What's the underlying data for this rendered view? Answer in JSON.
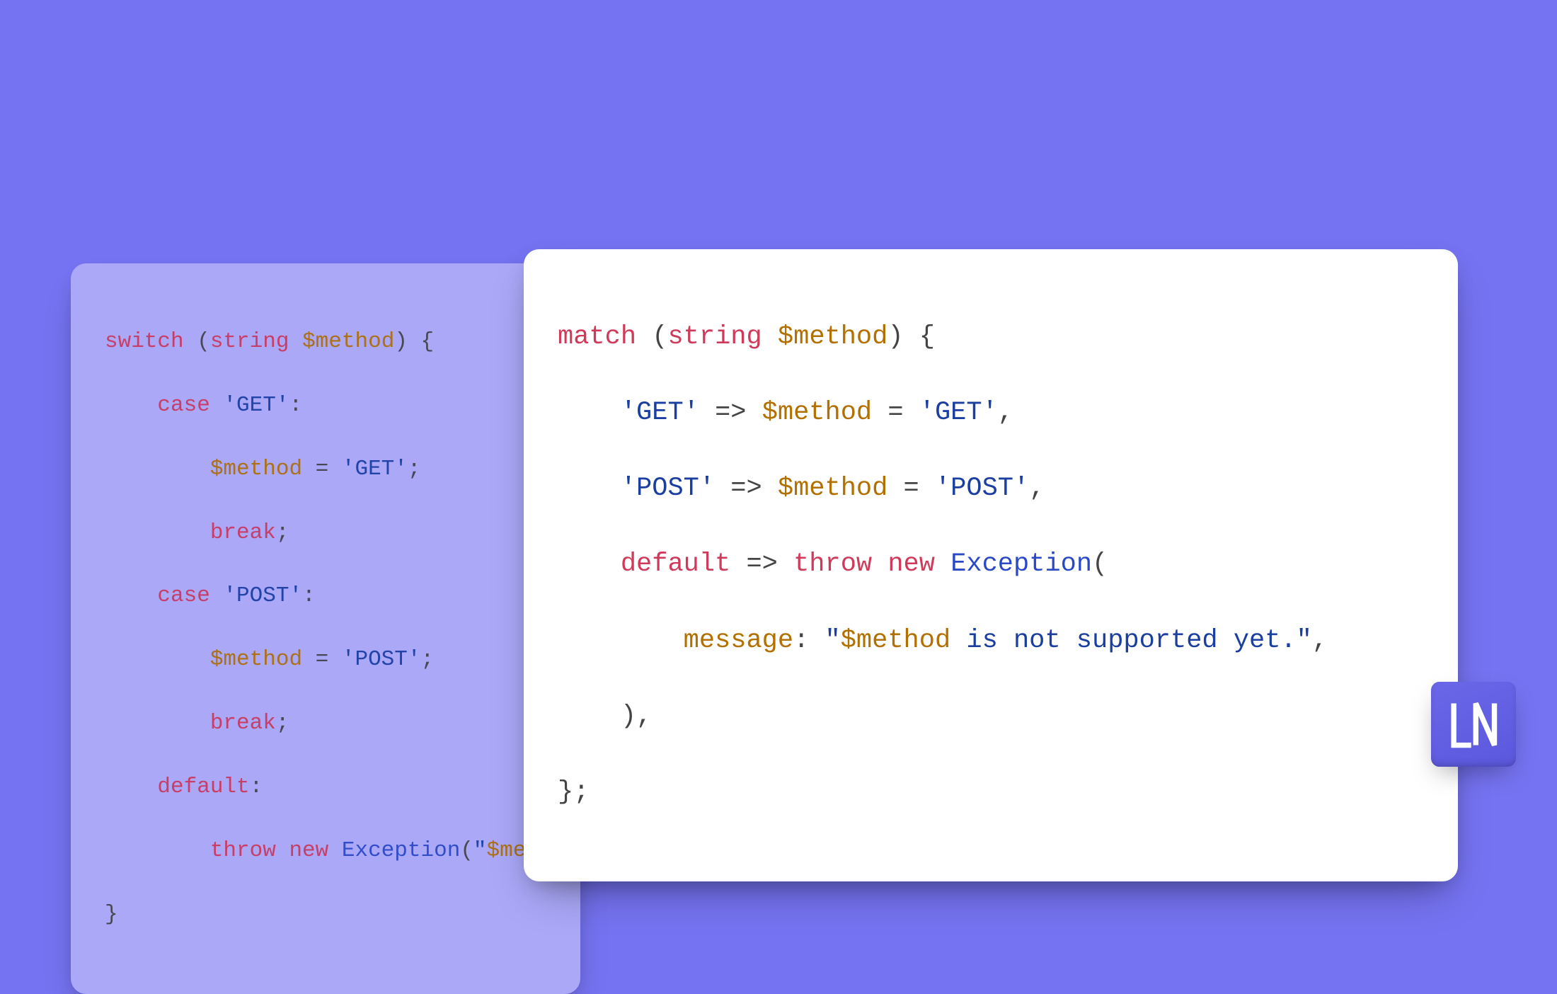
{
  "colors": {
    "background": "#7673f2",
    "card_left_bg": "rgba(255,255,255,0.42)",
    "card_right_bg": "#ffffff",
    "keyword": "#d03a5a",
    "string": "#1a3fa0",
    "variable": "#b27000",
    "class": "#2a49c7",
    "punct": "#444444"
  },
  "logo": {
    "text": "LN"
  },
  "left_code": {
    "l1": {
      "switch": "switch",
      "op": " (",
      "string_kw": "string",
      "sp": " ",
      "var": "$method",
      "cp": ") {"
    },
    "l2": {
      "indent": "    ",
      "case": "case",
      "sp": " ",
      "str": "'GET'",
      "colon": ":"
    },
    "l3": {
      "indent": "        ",
      "var": "$method",
      "eq": " = ",
      "str": "'GET'",
      "semi": ";"
    },
    "l4": {
      "indent": "        ",
      "break": "break",
      "semi": ";"
    },
    "l5": {
      "indent": "    ",
      "case": "case",
      "sp": " ",
      "str": "'POST'",
      "colon": ":"
    },
    "l6": {
      "indent": "        ",
      "var": "$method",
      "eq": " = ",
      "str": "'POST'",
      "semi": ";"
    },
    "l7": {
      "indent": "        ",
      "break": "break",
      "semi": ";"
    },
    "l8": {
      "indent": "    ",
      "default": "default",
      "colon": ":"
    },
    "l9": {
      "indent": "        ",
      "throw": "throw",
      "sp1": " ",
      "new": "new",
      "sp2": " ",
      "cls": "Exception",
      "op": "(",
      "strq": "\"",
      "var": "$met"
    },
    "l10": {
      "brace": "}"
    }
  },
  "right_code": {
    "l1": {
      "match": "match",
      "op": " (",
      "string_kw": "string",
      "sp": " ",
      "var": "$method",
      "cp": ") {"
    },
    "l2": {
      "indent": "    ",
      "str1": "'GET'",
      "arrow": " => ",
      "var": "$method",
      "eq": " = ",
      "str2": "'GET'",
      "comma": ","
    },
    "l3": {
      "indent": "    ",
      "str1": "'POST'",
      "arrow": " => ",
      "var": "$method",
      "eq": " = ",
      "str2": "'POST'",
      "comma": ","
    },
    "l4": {
      "indent": "    ",
      "default": "default",
      "arrow": " => ",
      "throw": "throw",
      "sp1": " ",
      "new": "new",
      "sp2": " ",
      "cls": "Exception",
      "op": "("
    },
    "l5": {
      "indent": "        ",
      "name": "message",
      "colon": ": ",
      "q1": "\"",
      "var": "$method",
      "rest": " is not supported yet.",
      "q2": "\"",
      "comma": ","
    },
    "l6": {
      "indent": "    ",
      "cp": "),",
      "dummy": ""
    },
    "l7": {
      "brace": "};"
    }
  }
}
